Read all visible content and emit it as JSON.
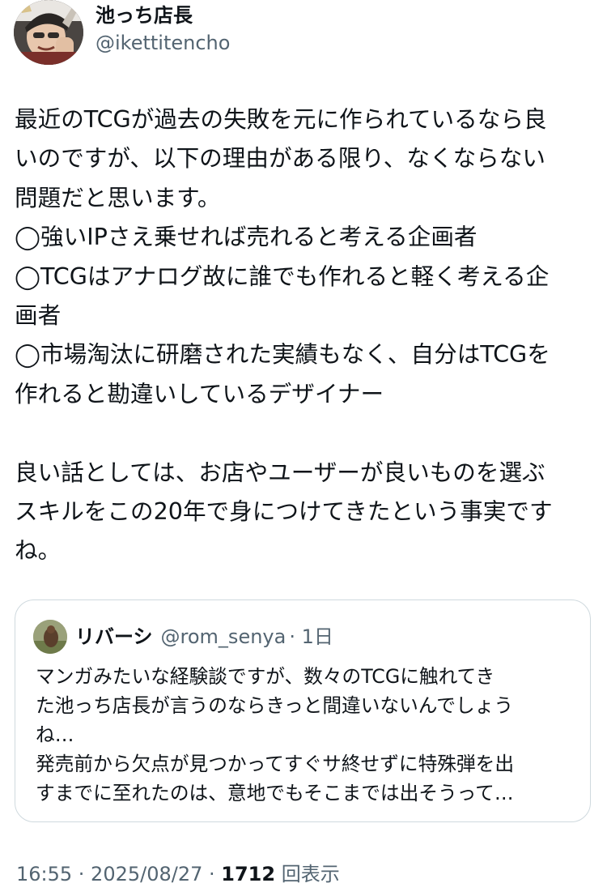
{
  "author": {
    "name": "池っち店長",
    "handle": "@ikettitencho"
  },
  "tweet": {
    "lines": [
      "最近のTCGが過去の失敗を元に作られているなら良",
      "いのですが、以下の理由がある限り、なくならない",
      "問題だと思います。",
      "◯強いIPさえ乗せれば売れると考える企画者",
      "◯TCGはアナログ故に誰でも作れると軽く考える企",
      "画者",
      "◯市場淘汰に研磨された実績もなく、自分はTCGを",
      "作れると勘違いしているデザイナー",
      "",
      "良い話としては、お店やユーザーが良いものを選ぶ",
      "スキルをこの20年で身につけてきたという事実です",
      "ね。"
    ]
  },
  "quote": {
    "name": "リバーシ",
    "handle": "@rom_senya",
    "time": "· 1日",
    "lines": [
      "マンガみたいな経験談ですが、数々のTCGに触れてき",
      "た池っち店長が言うのならきっと間違いないんでしょう",
      "ね…",
      "発売前から欠点が見つかってすぐサ終せずに特殊弾を出",
      "すまでに至れたのは、意地でもそこまでは出そうって…"
    ]
  },
  "meta": {
    "time": "16:55 · 2025/08/27 · ",
    "views_count": "1712",
    "views_label": " 回表示"
  }
}
